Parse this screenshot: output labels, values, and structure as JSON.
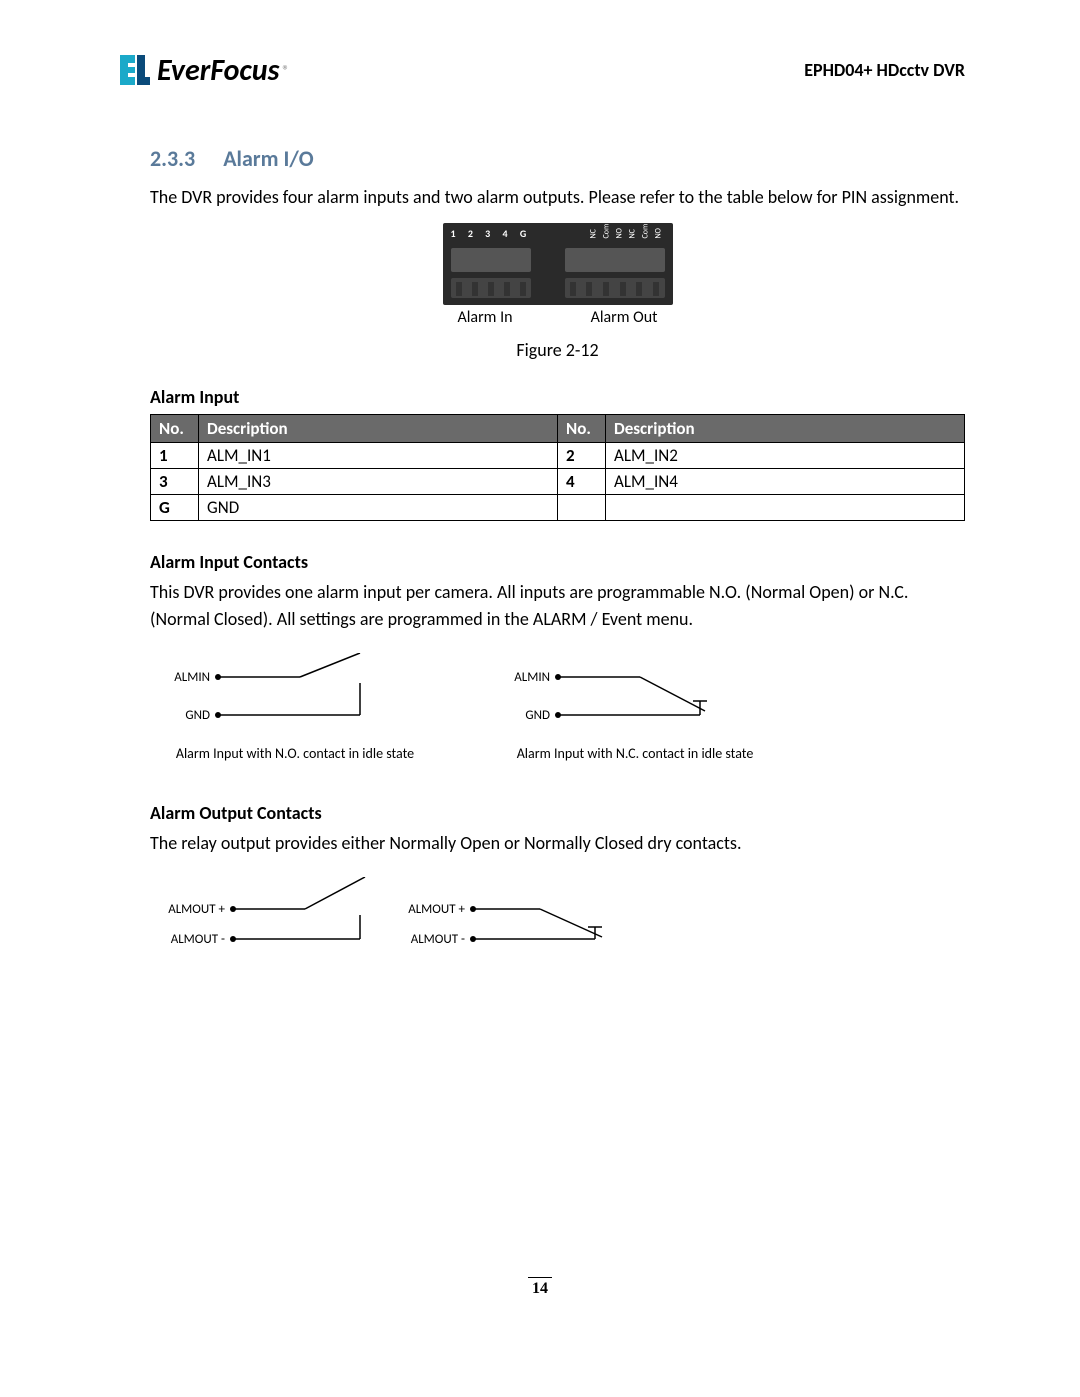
{
  "header": {
    "logo_text": "EverFocus",
    "logo_reg": "®",
    "product": "EPHD04+  HDcctv DVR"
  },
  "section": {
    "number": "2.3.3",
    "title": "Alarm I/O",
    "intro": "The DVR provides four alarm inputs and two alarm outputs. Please refer to the table below for PIN assignment."
  },
  "figure": {
    "pins_left": "1 2 3 4 G",
    "pins_right": [
      "NC",
      "Com",
      "NO",
      "NC",
      "Com",
      "NO"
    ],
    "left_label": "Alarm In",
    "right_label": "Alarm Out",
    "caption": "Figure 2-12"
  },
  "alarm_input": {
    "heading": "Alarm Input",
    "cols": [
      "No.",
      "Description",
      "No.",
      "Description"
    ],
    "rows": [
      [
        "1",
        "ALM_IN1",
        "2",
        "ALM_IN2"
      ],
      [
        "3",
        "ALM_IN3",
        "4",
        "ALM_IN4"
      ],
      [
        "G",
        "GND",
        "",
        ""
      ]
    ]
  },
  "alarm_input_contacts": {
    "heading": "Alarm Input Contacts",
    "para": "This DVR provides one alarm input per camera. All inputs are programmable N.O. (Normal Open) or N.C. (Normal Closed). All settings are programmed in the ALARM / Event menu.",
    "diag1": {
      "label_top": "ALMIN",
      "label_bottom": "GND",
      "caption": "Alarm Input with N.O. contact in idle state"
    },
    "diag2": {
      "label_top": "ALMIN",
      "label_bottom": "GND",
      "caption": "Alarm Input with N.C. contact in idle state"
    }
  },
  "alarm_output_contacts": {
    "heading": "Alarm Output Contacts",
    "para": "The relay output provides either Normally Open or Normally Closed dry contacts.",
    "diag1": {
      "label_top": "ALMOUT +",
      "label_bottom": "ALMOUT -"
    },
    "diag2": {
      "label_top": "ALMOUT +",
      "label_bottom": "ALMOUT -"
    }
  },
  "page_number": "14"
}
